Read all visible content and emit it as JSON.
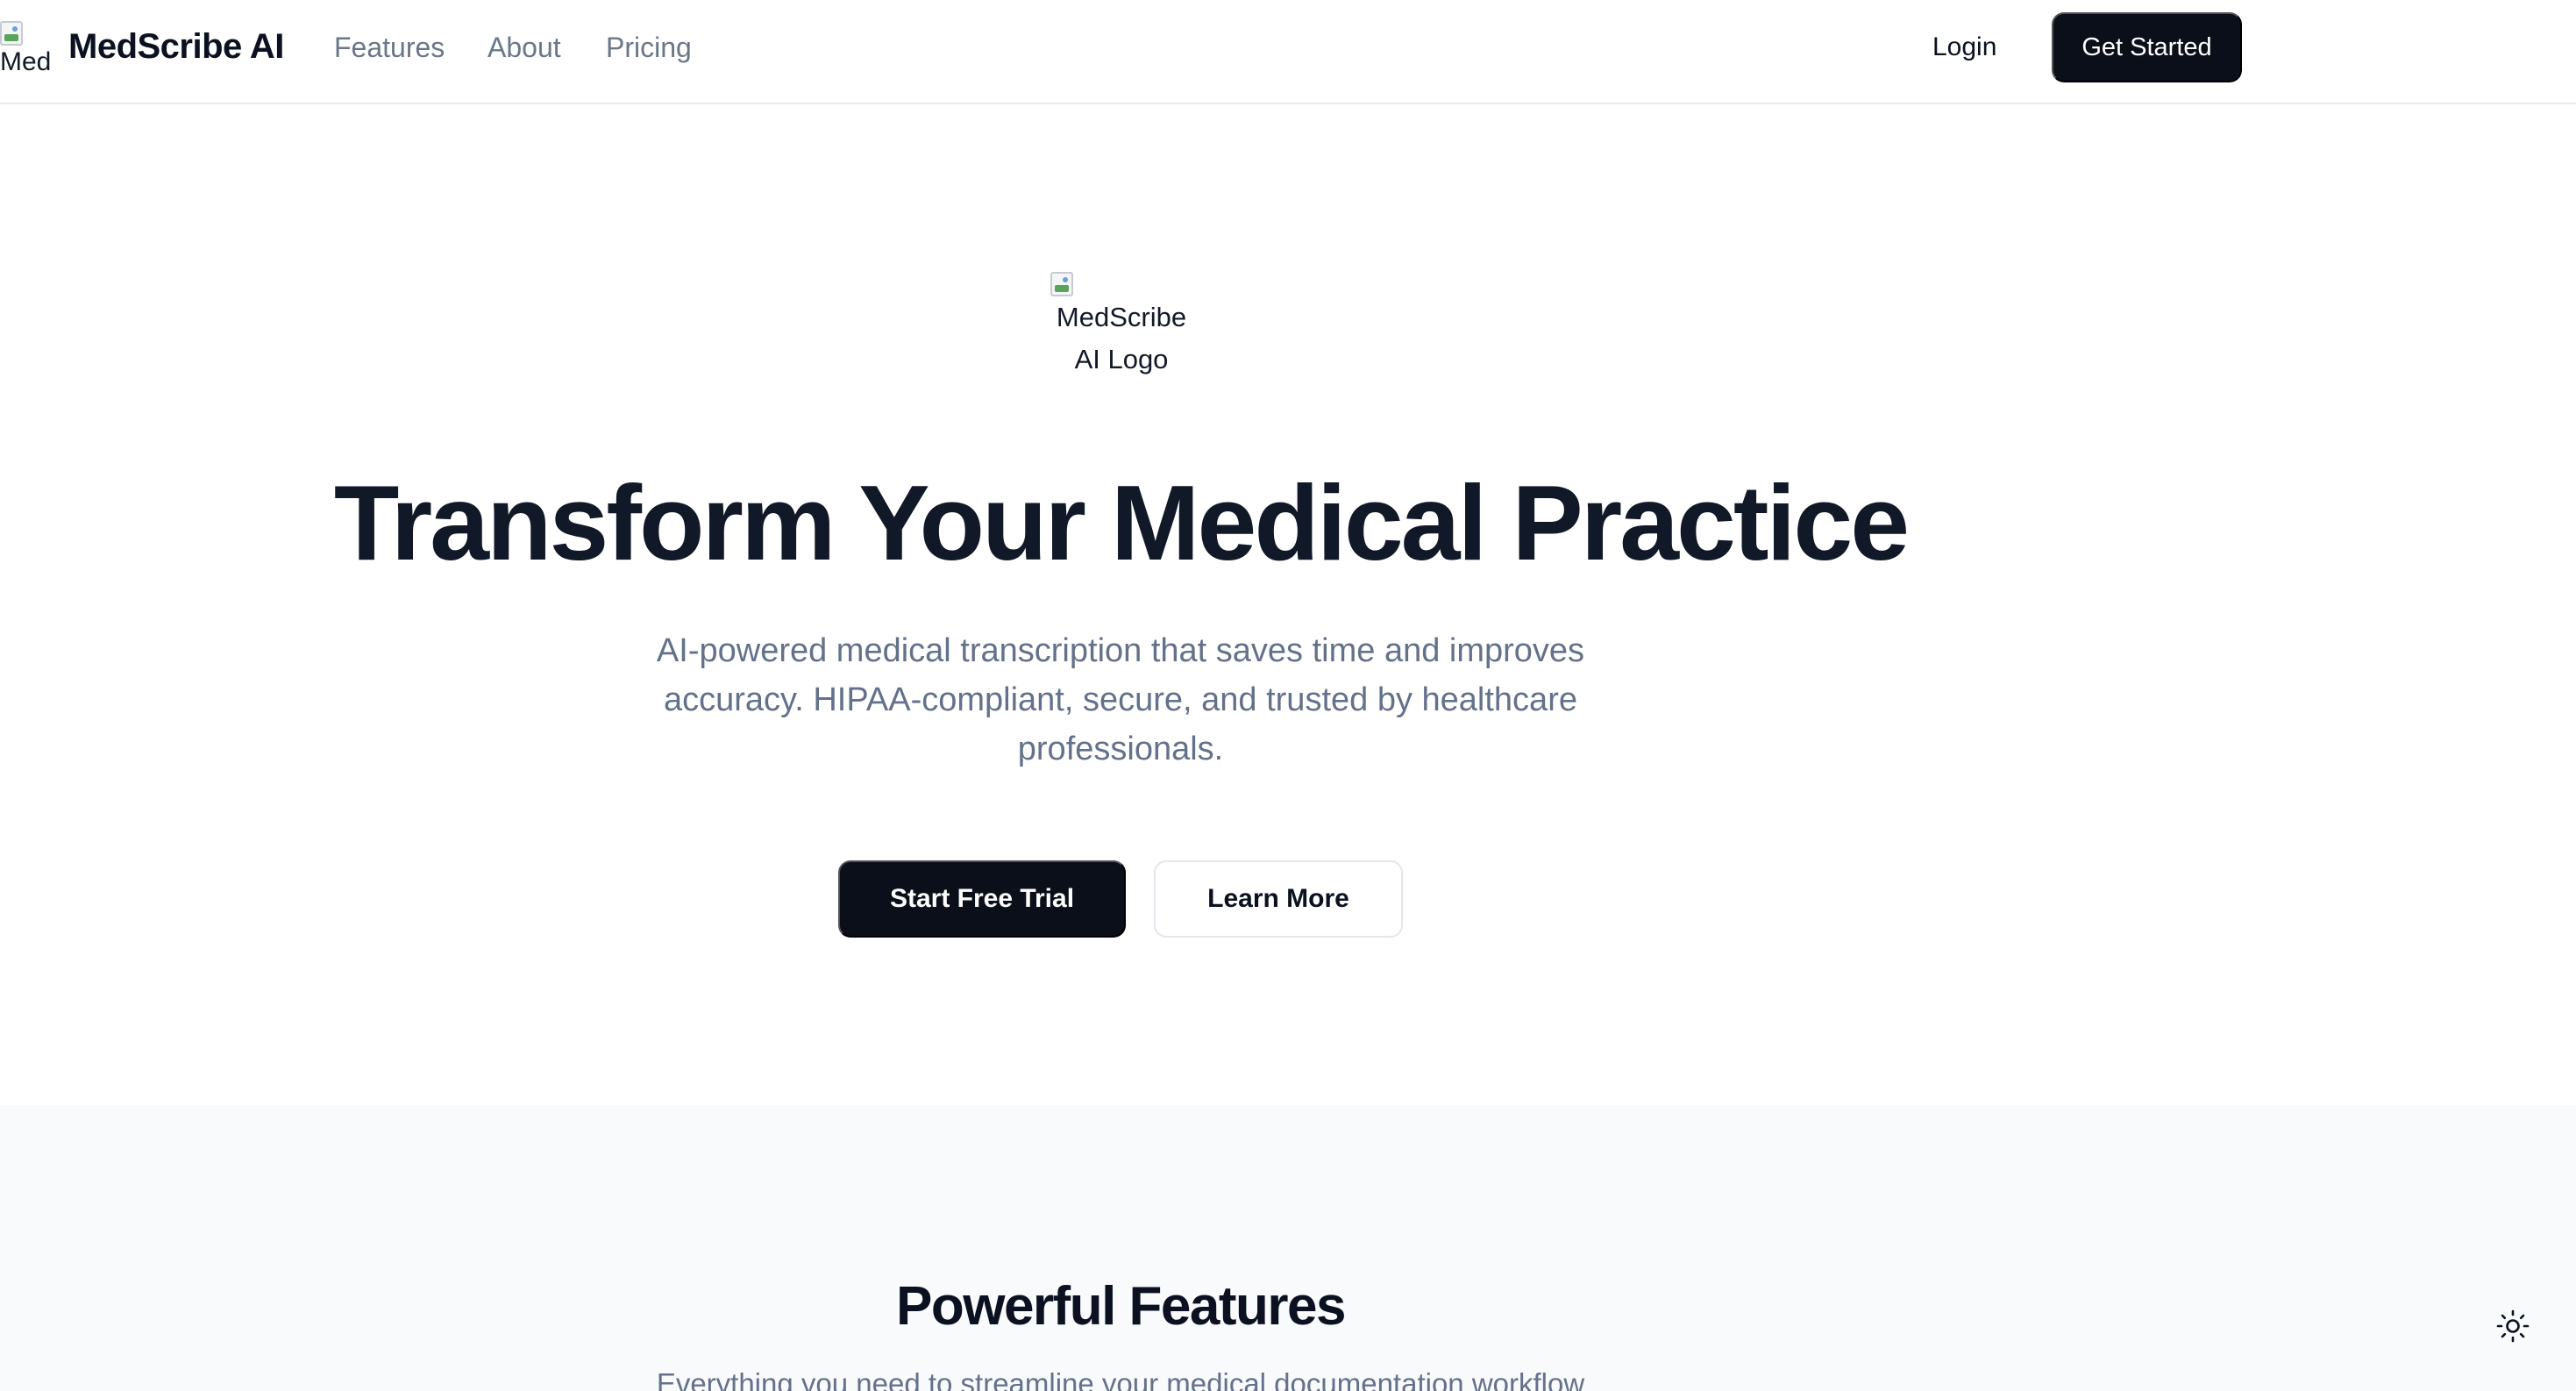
{
  "header": {
    "brand_logo_alt": "Med",
    "brand_name": "MedScribe AI",
    "nav": [
      "Features",
      "About",
      "Pricing"
    ],
    "login_label": "Login",
    "get_started_label": "Get Started"
  },
  "hero": {
    "logo_alt": "MedScribe AI Logo",
    "title": "Transform Your Medical Practice",
    "subtitle": "AI-powered medical transcription that saves time and improves accuracy. HIPAA-compliant, secure, and trusted by healthcare professionals.",
    "primary_cta": "Start Free Trial",
    "secondary_cta": "Learn More"
  },
  "features": {
    "title": "Powerful Features",
    "subtitle": "Everything you need to streamline your medical documentation workflow"
  },
  "icons": {
    "theme_toggle": "sun-icon"
  },
  "colors": {
    "primary": "#0b0f1a",
    "muted_text": "#64718a",
    "section_bg": "#f9fafc"
  }
}
